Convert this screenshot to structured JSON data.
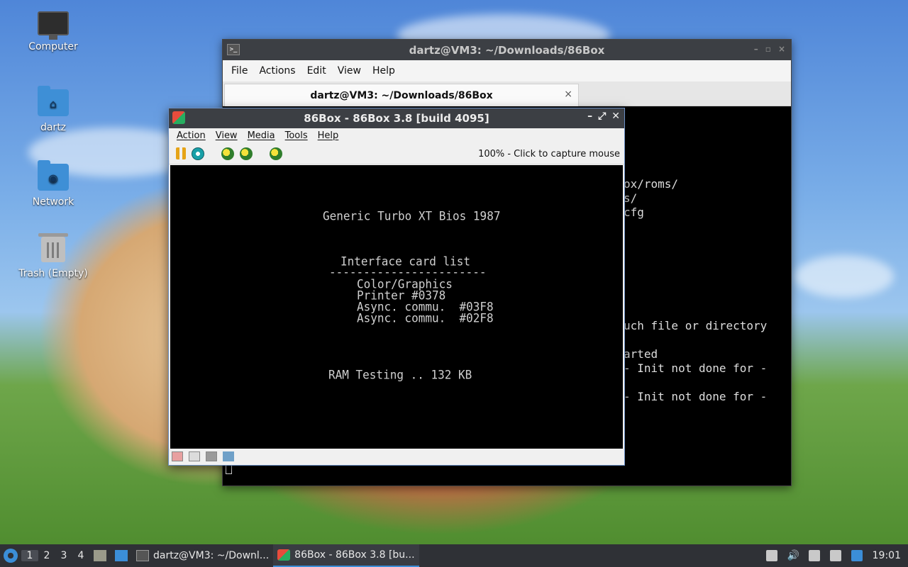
{
  "desktop": {
    "icons": [
      {
        "label": "Computer"
      },
      {
        "label": "dartz"
      },
      {
        "label": "Network"
      },
      {
        "label": "Trash (Empty)"
      }
    ]
  },
  "terminal": {
    "title": "dartz@VM3: ~/Downloads/86Box",
    "menu": [
      "File",
      "Actions",
      "Edit",
      "View",
      "Help"
    ],
    "tab_label": "dartz@VM3: ~/Downloads/86Box",
    "tab_close": "×",
    "visible_lines": [
      "ox/roms/",
      "s/",
      "cfg",
      "uch file or directory",
      "arted",
      "- Init not done for -",
      "- Init not done for -"
    ]
  },
  "box86": {
    "title": "86Box - 86Box 3.8 [build 4095]",
    "menu": [
      "Action",
      "View",
      "Media",
      "Tools",
      "Help"
    ],
    "capture_status": "100% - Click to capture mouse",
    "screen": {
      "bios_title": "Generic Turbo XT Bios 1987",
      "list_heading": "Interface card list",
      "list_rule": "-----------------------",
      "cards": [
        "Color/Graphics",
        "Printer #0378",
        "Async. commu.  #03F8",
        "Async. commu.  #02F8"
      ],
      "ram_test": "RAM Testing .. 132 KB"
    }
  },
  "taskbar": {
    "workspaces": [
      "1",
      "2",
      "3",
      "4"
    ],
    "apps": [
      {
        "label": "dartz@VM3: ~/Downl..."
      },
      {
        "label": "86Box - 86Box 3.8 [bu..."
      }
    ],
    "clock": "19:01"
  },
  "colors": {
    "accent": "#3b8ed8",
    "titlebar": "#3c3f44",
    "taskbar": "#2f3136"
  }
}
